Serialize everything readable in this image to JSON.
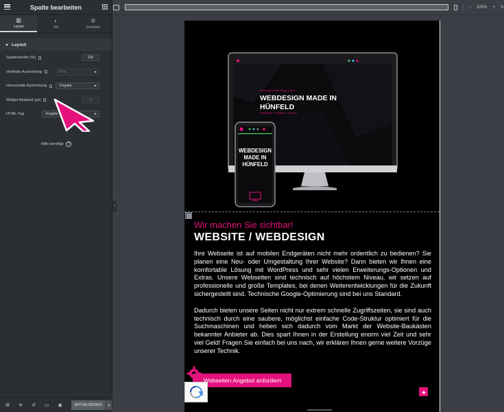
{
  "panel": {
    "title": "Spalte bearbeiten",
    "tabs": [
      {
        "label": "Layout",
        "icon": "layout-icon"
      },
      {
        "label": "Stil",
        "icon": "style-icon"
      },
      {
        "label": "Erweitert",
        "icon": "gear-icon"
      }
    ],
    "section_title": "Layout",
    "controls": {
      "column_width": {
        "label": "Spaltenbreite (%)",
        "value": "100"
      },
      "vertical_align": {
        "label": "Vertikale Ausrichtung",
        "value": "Mitte"
      },
      "horizontal_align": {
        "label": "Horizontale Ausrichtung",
        "value": "Vorgabe"
      },
      "widget_spacing": {
        "label": "Widget Abstand (px)",
        "value": "20"
      },
      "html_tag": {
        "label": "HTML-Tag",
        "value": "Vorgabe"
      }
    },
    "help_label": "Hilfe benötigt",
    "footer": {
      "update_label": "AKTUALISIEREN"
    }
  },
  "topbar": {
    "zoom": "100%"
  },
  "preview": {
    "laptop_kicker": "Webdesign Online Shops & SEO",
    "laptop_headline_1": "WEBDESIGN MADE IN",
    "laptop_headline_2": "HÜNFELD",
    "laptop_sub": "RESPONSIV · MODERN · SCHNELL",
    "phone_headline_1": "WEBDESIGN",
    "phone_headline_2": "MADE IN",
    "phone_headline_3": "HÜNFELD",
    "subheading": "Wir machen Sie sichtbar!",
    "heading": "WEBSITE / WEBDESIGN",
    "paragraph_1": "Ihre Webseite ist auf mobilen Endgeräten nicht mehr ordentlich zu bedienen? Sie planen eine Neu- oder Umgestaltung Ihrer Website? Dann bieten wir Ihnen eine komfortable Lösung mit WordPress und sehr vielen Erweiterungs-Optionen und Extras. Unsere Webseiten sind technisch auf höchstem Niveau, wir setzen auf professionelle und große Templates, bei denen Weiterentwicklungen für die Zukunft sichergestellt sind. Technische Google-Optimierung sind bei uns Standard.",
    "paragraph_2": "Dadurch bieten unsere Seiten nicht nur extrem schnelle Zugriffszeiten, sie sind auch technisch durch eine saubere, möglichst einfache Code-Struktur optimiert für die Suchmaschinen und heben sich dadurch vom Markt der Website-Baukästen bekannter Anbieter ab. Dies spart Ihnen in der Erstellung enorm viel Zeit und sehr viel Geld! Fragen Sie einfach bei uns nach, wir erklären Ihnen gerne weitere Vorzüge unserer Technik.",
    "cta_label": "Webseiten Angebot anfordern"
  },
  "colors": {
    "accent": "#e5127d",
    "panel_bg": "#2b2e33",
    "canvas_bg": "#3b3f45"
  }
}
